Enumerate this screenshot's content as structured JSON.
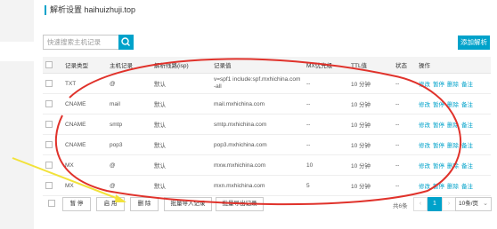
{
  "page_title": "解析设置 haihuizhuji.top",
  "search": {
    "placeholder": "快速搜索主机记录"
  },
  "add_button": "添加解析",
  "table": {
    "headers": [
      "记录类型",
      "主机记录",
      "解析线路(isp)",
      "记录值",
      "MX优先级",
      "TTL值",
      "状态",
      "操作"
    ],
    "rows": [
      {
        "type": "TXT",
        "host": "@",
        "line": "默认",
        "value": "v=spf1 include:spf.mxhichina.com -all",
        "mx": "--",
        "ttl": "10 分钟",
        "status": "--"
      },
      {
        "type": "CNAME",
        "host": "mail",
        "line": "默认",
        "value": "mail.mxhichina.com",
        "mx": "--",
        "ttl": "10 分钟",
        "status": "--"
      },
      {
        "type": "CNAME",
        "host": "smtp",
        "line": "默认",
        "value": "smtp.mxhichina.com",
        "mx": "--",
        "ttl": "10 分钟",
        "status": "--"
      },
      {
        "type": "CNAME",
        "host": "pop3",
        "line": "默认",
        "value": "pop3.mxhichina.com",
        "mx": "--",
        "ttl": "10 分钟",
        "status": "--"
      },
      {
        "type": "MX",
        "host": "@",
        "line": "默认",
        "value": "mxw.mxhichina.com",
        "mx": "10",
        "ttl": "10 分钟",
        "status": "--"
      },
      {
        "type": "MX",
        "host": "@",
        "line": "默认",
        "value": "mxn.mxhichina.com",
        "mx": "5",
        "ttl": "10 分钟",
        "status": "--"
      }
    ],
    "actions": [
      "修改",
      "暂停",
      "删除",
      "备注"
    ]
  },
  "footer": {
    "pause": "暂 停",
    "enable": "启 用",
    "delete": "删 除",
    "import": "批量导入记录",
    "export": "批量导出记录",
    "total": "共6条",
    "prev": "‹",
    "page": "1",
    "next": "›",
    "page_size": "10条/页"
  },
  "colors": {
    "accent": "#00a2ca",
    "annotation_red": "#e0322b",
    "annotation_arrow": "#f2e23a"
  }
}
